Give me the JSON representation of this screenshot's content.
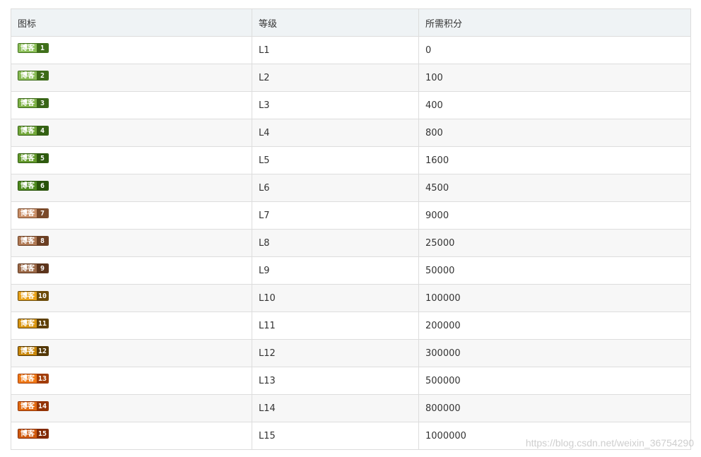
{
  "table": {
    "headers": [
      "图标",
      "等级",
      "所需积分"
    ],
    "rows": [
      {
        "badge_text": "博客",
        "badge_num": "1",
        "level": "L1",
        "points": "0",
        "badge_colors": [
          "#8dc05a",
          "#3f6f1a"
        ]
      },
      {
        "badge_text": "博客",
        "badge_num": "2",
        "level": "L2",
        "points": "100",
        "badge_colors": [
          "#88bb55",
          "#3c6a18"
        ]
      },
      {
        "badge_text": "博客",
        "badge_num": "3",
        "level": "L3",
        "points": "400",
        "badge_colors": [
          "#7fb248",
          "#386516"
        ]
      },
      {
        "badge_text": "博客",
        "badge_num": "4",
        "level": "L4",
        "points": "800",
        "badge_colors": [
          "#73a83a",
          "#336012"
        ]
      },
      {
        "badge_text": "博客",
        "badge_num": "5",
        "level": "L5",
        "points": "1600",
        "badge_colors": [
          "#649a2c",
          "#2e5a0e"
        ]
      },
      {
        "badge_text": "博客",
        "badge_num": "6",
        "level": "L6",
        "points": "4500",
        "badge_colors": [
          "#4f8a1f",
          "#28520a"
        ]
      },
      {
        "badge_text": "博客",
        "badge_num": "7",
        "level": "L7",
        "points": "9000",
        "badge_colors": [
          "#c98f68",
          "#7a4a2a"
        ]
      },
      {
        "badge_text": "博客",
        "badge_num": "8",
        "level": "L8",
        "points": "25000",
        "badge_colors": [
          "#b07a55",
          "#6a3e22"
        ]
      },
      {
        "badge_text": "博客",
        "badge_num": "9",
        "level": "L9",
        "points": "50000",
        "badge_colors": [
          "#9c6a48",
          "#5c341c"
        ]
      },
      {
        "badge_text": "博客",
        "badge_num": "10",
        "level": "L10",
        "points": "100000",
        "badge_colors": [
          "#e8a21a",
          "#6b4a08"
        ]
      },
      {
        "badge_text": "博客",
        "badge_num": "11",
        "level": "L11",
        "points": "200000",
        "badge_colors": [
          "#d99612",
          "#5e4006"
        ]
      },
      {
        "badge_text": "博客",
        "badge_num": "12",
        "level": "L12",
        "points": "300000",
        "badge_colors": [
          "#c8870c",
          "#523604"
        ]
      },
      {
        "badge_text": "博客",
        "badge_num": "13",
        "level": "L13",
        "points": "500000",
        "badge_colors": [
          "#f07a16",
          "#a23c06"
        ]
      },
      {
        "badge_text": "博客",
        "badge_num": "14",
        "level": "L14",
        "points": "800000",
        "badge_colors": [
          "#e06a12",
          "#923204"
        ]
      },
      {
        "badge_text": "博客",
        "badge_num": "15",
        "level": "L15",
        "points": "1000000",
        "badge_colors": [
          "#d05a0e",
          "#822a04"
        ]
      }
    ]
  },
  "watermark": "https://blog.csdn.net/weixin_36754290"
}
